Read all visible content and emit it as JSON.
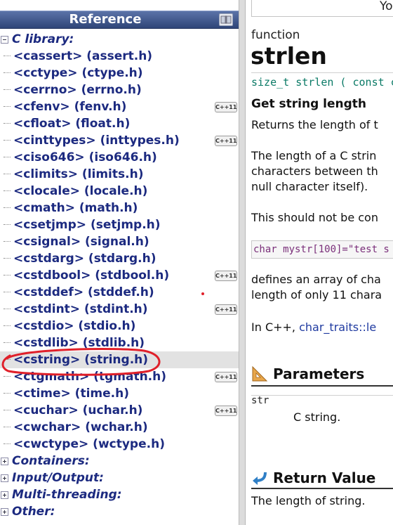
{
  "reference": {
    "title": "Reference",
    "header_icon": "cpp-logo-icon"
  },
  "tree": [
    {
      "type": "cat",
      "label": "C library:",
      "expanded": true
    },
    {
      "type": "item",
      "label": "<cassert> (assert.h)",
      "badge": ""
    },
    {
      "type": "item",
      "label": "<cctype> (ctype.h)",
      "badge": ""
    },
    {
      "type": "item",
      "label": "<cerrno> (errno.h)",
      "badge": ""
    },
    {
      "type": "item",
      "label": "<cfenv> (fenv.h)",
      "badge": "C++11"
    },
    {
      "type": "item",
      "label": "<cfloat> (float.h)",
      "badge": ""
    },
    {
      "type": "item",
      "label": "<cinttypes> (inttypes.h)",
      "badge": "C++11"
    },
    {
      "type": "item",
      "label": "<ciso646> (iso646.h)",
      "badge": ""
    },
    {
      "type": "item",
      "label": "<climits> (limits.h)",
      "badge": ""
    },
    {
      "type": "item",
      "label": "<clocale> (locale.h)",
      "badge": ""
    },
    {
      "type": "item",
      "label": "<cmath> (math.h)",
      "badge": ""
    },
    {
      "type": "item",
      "label": "<csetjmp> (setjmp.h)",
      "badge": ""
    },
    {
      "type": "item",
      "label": "<csignal> (signal.h)",
      "badge": ""
    },
    {
      "type": "item",
      "label": "<cstdarg> (stdarg.h)",
      "badge": ""
    },
    {
      "type": "item",
      "label": "<cstdbool> (stdbool.h)",
      "badge": "C++11"
    },
    {
      "type": "item",
      "label": "<cstddef> (stddef.h)",
      "badge": ""
    },
    {
      "type": "item",
      "label": "<cstdint> (stdint.h)",
      "badge": "C++11"
    },
    {
      "type": "item",
      "label": "<cstdio> (stdio.h)",
      "badge": ""
    },
    {
      "type": "item",
      "label": "<cstdlib> (stdlib.h)",
      "badge": ""
    },
    {
      "type": "item",
      "label": "<cstring> (string.h)",
      "badge": "",
      "selected": true
    },
    {
      "type": "item",
      "label": "<ctgmath> (tgmath.h)",
      "badge": "C++11"
    },
    {
      "type": "item",
      "label": "<ctime> (time.h)",
      "badge": ""
    },
    {
      "type": "item",
      "label": "<cuchar> (uchar.h)",
      "badge": "C++11"
    },
    {
      "type": "item",
      "label": "<cwchar> (wchar.h)",
      "badge": ""
    },
    {
      "type": "item",
      "label": "<cwctype> (wctype.h)",
      "badge": ""
    },
    {
      "type": "cat",
      "label": "Containers:",
      "expanded": false
    },
    {
      "type": "cat",
      "label": "Input/Output:",
      "expanded": false
    },
    {
      "type": "cat",
      "label": "Multi-threading:",
      "expanded": false
    },
    {
      "type": "cat",
      "label": "Other:",
      "expanded": false
    }
  ],
  "content": {
    "top_box_text": "Yo",
    "kind": "function",
    "name": "strlen",
    "prototype": "size_t strlen ( const c",
    "subtitle": "Get string length",
    "p1": "Returns the length of t",
    "p2_line1": "The length of a C strin",
    "p2_line2": "characters between th",
    "p2_line3": "null character itself).",
    "p3": "This should not be con",
    "code": "char mystr[100]=\"test s",
    "p4_line1": "defines an array of cha",
    "p4_line2": "length of only 11 chara",
    "p5_prefix": "In C++, ",
    "p5_link": "char_traits::le",
    "parameters_heading": "Parameters",
    "param_name": "str",
    "param_desc": "C string.",
    "return_heading": "Return Value",
    "return_text": "The length of string."
  },
  "colors": {
    "header_bg": "#3d5590",
    "tree_text": "#1c2a80",
    "link": "#1f3aa0",
    "prototype": "#0a7a66",
    "annotation": "#e0202a"
  }
}
